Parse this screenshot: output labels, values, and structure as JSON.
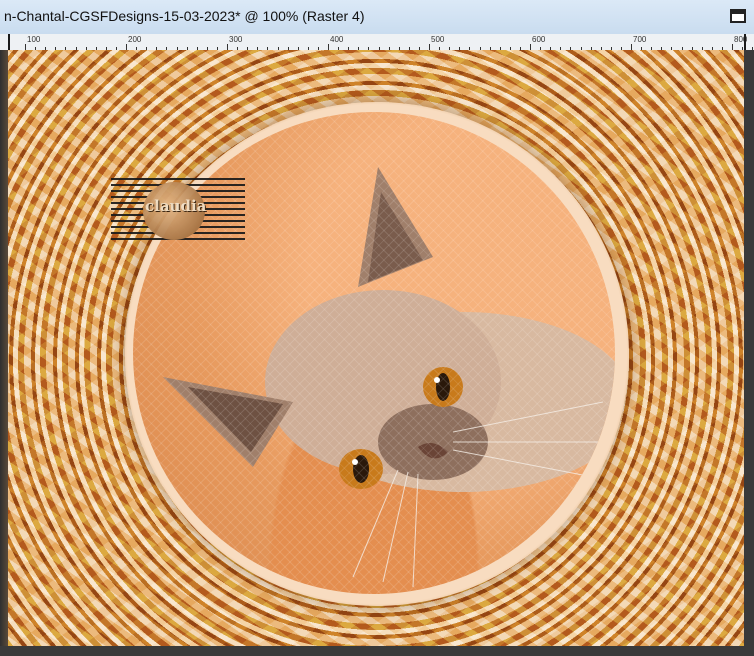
{
  "window": {
    "title": "n-Chantal-CGSFDesigns-15-03-2023* @ 100% (Raster 4)"
  },
  "ruler": {
    "labels": [
      "100",
      "200",
      "300",
      "400",
      "500",
      "600",
      "700",
      "800"
    ]
  },
  "artwork": {
    "watermark_text": "claudia",
    "subject": "cat"
  },
  "icons": {
    "maximize": "maximize-icon"
  }
}
